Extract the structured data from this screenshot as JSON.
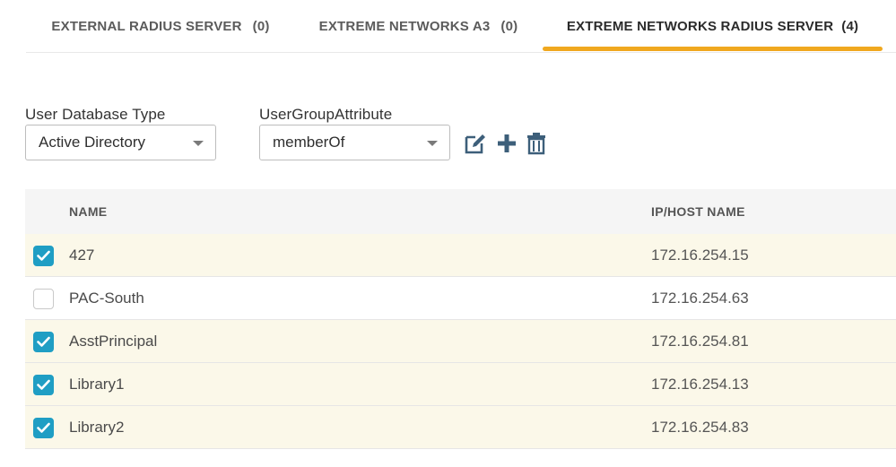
{
  "tabs": [
    {
      "label": "EXTERNAL RADIUS SERVER",
      "count": "(0)",
      "active": false
    },
    {
      "label": "EXTREME NETWORKS A3",
      "count": "(0)",
      "active": false
    },
    {
      "label": "EXTREME NETWORKS RADIUS SERVER",
      "count": "(4)",
      "active": true
    }
  ],
  "form": {
    "user_db_label": "User Database Type",
    "user_db_value": "Active Directory",
    "group_attr_label": "UserGroupAttribute",
    "group_attr_value": "memberOf"
  },
  "toolbar": {
    "edit_icon": "edit-icon",
    "add_icon": "plus-icon",
    "delete_icon": "trash-icon"
  },
  "table": {
    "headers": {
      "name": "NAME",
      "ip": "IP/HOST NAME"
    },
    "rows": [
      {
        "name": "427",
        "ip": "172.16.254.15",
        "checked": true
      },
      {
        "name": "PAC-South",
        "ip": "172.16.254.63",
        "checked": false
      },
      {
        "name": "AsstPrincipal",
        "ip": "172.16.254.81",
        "checked": true
      },
      {
        "name": "Library1",
        "ip": "172.16.254.13",
        "checked": true
      },
      {
        "name": "Library2",
        "ip": "172.16.254.83",
        "checked": true
      }
    ]
  },
  "colors": {
    "accent_tab": "#f0a81f",
    "checkbox_on": "#1f9ec4",
    "icon": "#3d5f7a",
    "selected_row": "#fbf8e9"
  }
}
